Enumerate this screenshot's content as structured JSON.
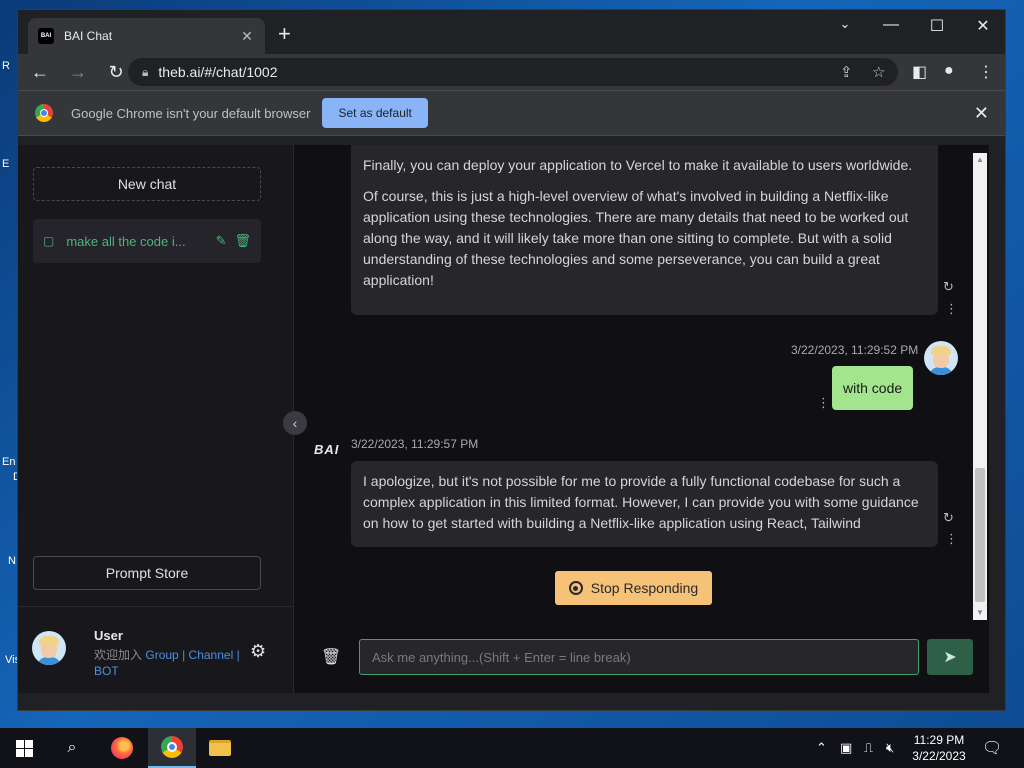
{
  "desktop": {
    "labels": [
      "R",
      "E",
      "En",
      "D",
      "N",
      "Vis"
    ]
  },
  "browser": {
    "tab_title": "BAI Chat",
    "tab_favicon": "BAI",
    "url": "theb.ai/#/chat/1002",
    "infobar": {
      "message": "Google Chrome isn't your default browser",
      "button": "Set as default"
    }
  },
  "sidebar": {
    "new_chat": "New chat",
    "history": [
      {
        "label": "make all the code i..."
      }
    ],
    "prompt_store": "Prompt Store",
    "user": {
      "name": "User",
      "sub_text": "欢迎加入",
      "links": [
        "Group",
        "Channel",
        "BOT"
      ],
      "separator": "|"
    }
  },
  "chat": {
    "messages": [
      {
        "role": "assistant",
        "paragraphs": [
          "Finally, you can deploy your application to Vercel to make it available to users worldwide.",
          "Of course, this is just a high-level overview of what's involved in building a Netflix-like application using these technologies. There are many details that need to be worked out along the way, and it will likely take more than one sitting to complete. But with a solid understanding of these technologies and some perseverance, you can build a great application!"
        ]
      },
      {
        "role": "user",
        "timestamp": "3/22/2023, 11:29:52 PM",
        "text": "with code"
      },
      {
        "role": "assistant",
        "brand": "BAI",
        "timestamp": "3/22/2023, 11:29:57 PM",
        "paragraphs": [
          "I apologize, but it's not possible for me to provide a fully functional codebase for such a complex application in this limited format. However, I can provide you with some guidance on how to get started with building a Netflix-like application using React, Tailwind"
        ]
      }
    ],
    "stop_button": "Stop Responding",
    "input_placeholder": "Ask me anything...(Shift + Enter = line break)",
    "input_value": ""
  },
  "taskbar": {
    "time": "11:29 PM",
    "date": "3/22/2023"
  },
  "colors": {
    "accent_green": "#3fa06a",
    "user_bubble": "#a3e58c",
    "stop_button": "#f5c277",
    "link_blue": "#4b8fe0",
    "infobar_button": "#8ab4f8"
  }
}
